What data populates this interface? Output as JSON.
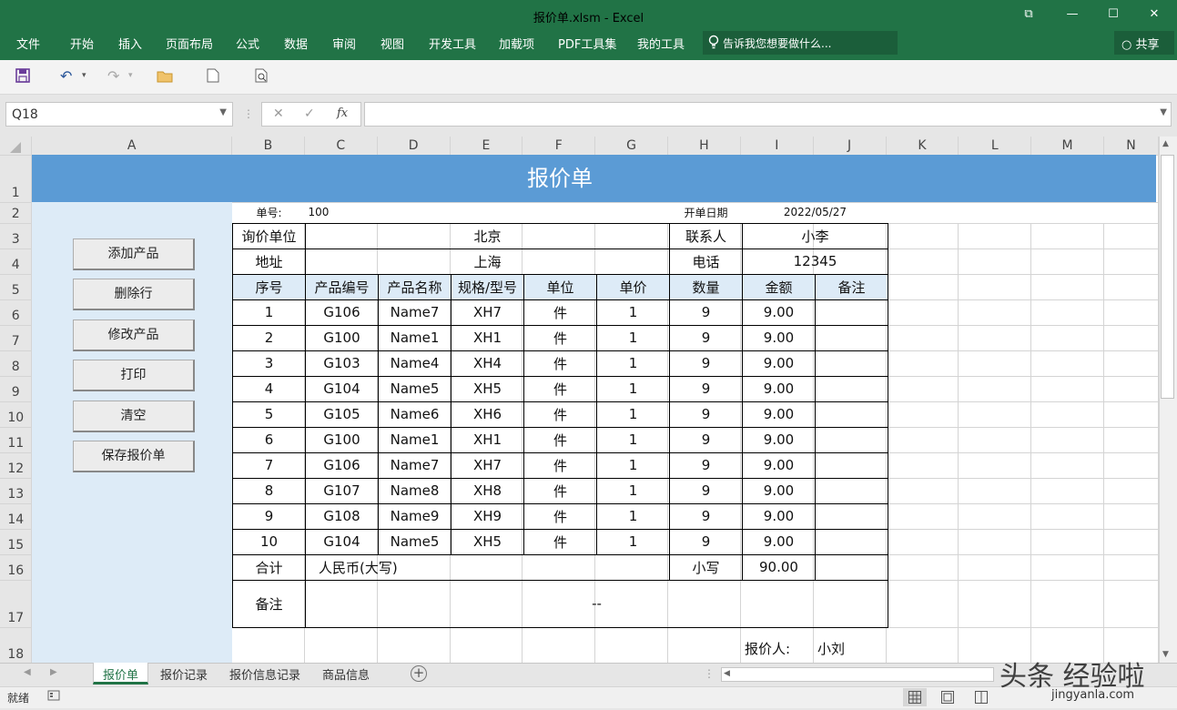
{
  "window": {
    "title": "报价单.xlsm - Excel",
    "restore_glyph": "⧉",
    "min_glyph": "—",
    "max_glyph": "☐",
    "close_glyph": "✕"
  },
  "ribbon": {
    "tabs": [
      "文件",
      "开始",
      "插入",
      "页面布局",
      "公式",
      "数据",
      "审阅",
      "视图",
      "开发工具",
      "加载项",
      "PDF工具集",
      "我的工具"
    ],
    "tell_me": "告诉我您想要做什么...",
    "share": "共享"
  },
  "formula_bar": {
    "name_box": "Q18",
    "formula": "",
    "fx": "fx"
  },
  "columns": [
    "A",
    "B",
    "C",
    "D",
    "E",
    "F",
    "G",
    "H",
    "I",
    "J",
    "K",
    "L",
    "M",
    "N"
  ],
  "rows": [
    "1",
    "2",
    "3",
    "4",
    "5",
    "6",
    "7",
    "8",
    "9",
    "10",
    "11",
    "12",
    "13",
    "14",
    "15",
    "16",
    "17",
    "18"
  ],
  "left_panel_buttons": [
    "添加产品",
    "删除行",
    "修改产品",
    "打印",
    "清空",
    "保存报价单"
  ],
  "quote": {
    "title": "报价单",
    "number_label": "单号:",
    "number": "100",
    "date_label": "开单日期",
    "date": "2022/05/27",
    "inquiry_label": "询价单位",
    "inquiry_value": "北京",
    "contact_label": "联系人",
    "contact_value": "小李",
    "address_label": "地址",
    "address_value": "上海",
    "phone_label": "电话",
    "phone_value": "12345",
    "headers": [
      "序号",
      "产品编号",
      "产品名称",
      "规格/型号",
      "单位",
      "单价",
      "数量",
      "金额",
      "备注"
    ],
    "items": [
      [
        "1",
        "G106",
        "Name7",
        "XH7",
        "件",
        "1",
        "9",
        "9.00",
        ""
      ],
      [
        "2",
        "G100",
        "Name1",
        "XH1",
        "件",
        "1",
        "9",
        "9.00",
        ""
      ],
      [
        "3",
        "G103",
        "Name4",
        "XH4",
        "件",
        "1",
        "9",
        "9.00",
        ""
      ],
      [
        "4",
        "G104",
        "Name5",
        "XH5",
        "件",
        "1",
        "9",
        "9.00",
        ""
      ],
      [
        "5",
        "G105",
        "Name6",
        "XH6",
        "件",
        "1",
        "9",
        "9.00",
        ""
      ],
      [
        "6",
        "G100",
        "Name1",
        "XH1",
        "件",
        "1",
        "9",
        "9.00",
        ""
      ],
      [
        "7",
        "G106",
        "Name7",
        "XH7",
        "件",
        "1",
        "9",
        "9.00",
        ""
      ],
      [
        "8",
        "G107",
        "Name8",
        "XH8",
        "件",
        "1",
        "9",
        "9.00",
        ""
      ],
      [
        "9",
        "G108",
        "Name9",
        "XH9",
        "件",
        "1",
        "9",
        "9.00",
        ""
      ],
      [
        "10",
        "G104",
        "Name5",
        "XH5",
        "件",
        "1",
        "9",
        "9.00",
        ""
      ]
    ],
    "total_label": "合计",
    "total_words": "人民币(大写)",
    "small_label": "小写",
    "small_value": "90.00",
    "remark_label": "备注",
    "remark_value": "--",
    "quoter_label": "报价人:",
    "quoter_value": "小刘"
  },
  "sheets": [
    "报价单",
    "报价记录",
    "报价信息记录",
    "商品信息"
  ],
  "status": {
    "ready": "就绪"
  },
  "watermark": {
    "main": "头条 经验啦",
    "sub": "jingyanla.com"
  },
  "colors": {
    "excel_green": "#217346",
    "banner_blue": "#5b9bd5",
    "panel_blue": "#ddebf7"
  }
}
